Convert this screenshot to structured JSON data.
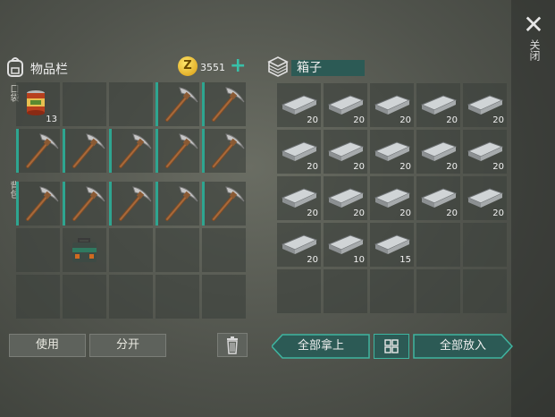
{
  "window": {
    "close_label": "关闭"
  },
  "inventory": {
    "title": "物品栏",
    "coins": "3551",
    "pocket_label": "口袋",
    "backpack_label": "背包",
    "pocket_slots": [
      {
        "item": "can",
        "count": "13"
      },
      {
        "item": "",
        "count": ""
      },
      {
        "item": "",
        "count": ""
      },
      {
        "item": "pickaxe",
        "count": "",
        "hl": true
      },
      {
        "item": "pickaxe",
        "count": "",
        "hl": true
      },
      {
        "item": "pickaxe",
        "count": "",
        "hl": true
      },
      {
        "item": "pickaxe",
        "count": "",
        "hl": true
      },
      {
        "item": "pickaxe",
        "count": "",
        "hl": true
      },
      {
        "item": "pickaxe",
        "count": "",
        "hl": true
      },
      {
        "item": "pickaxe",
        "count": "",
        "hl": true
      }
    ],
    "backpack_slots": [
      {
        "item": "pickaxe",
        "count": "",
        "hl": true
      },
      {
        "item": "pickaxe",
        "count": "",
        "hl": true
      },
      {
        "item": "pickaxe",
        "count": "",
        "hl": true
      },
      {
        "item": "pickaxe",
        "count": "",
        "hl": true
      },
      {
        "item": "pickaxe",
        "count": "",
        "hl": true
      },
      {
        "item": "",
        "count": ""
      },
      {
        "item": "toolbox",
        "count": ""
      },
      {
        "item": "",
        "count": ""
      },
      {
        "item": "",
        "count": ""
      },
      {
        "item": "",
        "count": ""
      },
      {
        "item": "",
        "count": ""
      },
      {
        "item": "",
        "count": ""
      },
      {
        "item": "",
        "count": ""
      },
      {
        "item": "",
        "count": ""
      },
      {
        "item": "",
        "count": ""
      }
    ],
    "buttons": {
      "use": "使用",
      "split": "分开"
    }
  },
  "chest": {
    "name": "箱子",
    "slots": [
      {
        "item": "ingot",
        "count": "20"
      },
      {
        "item": "ingot",
        "count": "20"
      },
      {
        "item": "ingot",
        "count": "20"
      },
      {
        "item": "ingot",
        "count": "20"
      },
      {
        "item": "ingot",
        "count": "20"
      },
      {
        "item": "ingot",
        "count": "20"
      },
      {
        "item": "ingot",
        "count": "20"
      },
      {
        "item": "ingot",
        "count": "20"
      },
      {
        "item": "ingot",
        "count": "20"
      },
      {
        "item": "ingot",
        "count": "20"
      },
      {
        "item": "ingot",
        "count": "20"
      },
      {
        "item": "ingot",
        "count": "20"
      },
      {
        "item": "ingot",
        "count": "20"
      },
      {
        "item": "ingot",
        "count": "20"
      },
      {
        "item": "ingot",
        "count": "20"
      },
      {
        "item": "ingot",
        "count": "20"
      },
      {
        "item": "ingot",
        "count": "10"
      },
      {
        "item": "ingot",
        "count": "15"
      },
      {
        "item": "",
        "count": ""
      },
      {
        "item": "",
        "count": ""
      },
      {
        "item": "",
        "count": ""
      },
      {
        "item": "",
        "count": ""
      },
      {
        "item": "",
        "count": ""
      },
      {
        "item": "",
        "count": ""
      },
      {
        "item": "",
        "count": ""
      }
    ],
    "buttons": {
      "take_all": "全部拿上",
      "put_all": "全部放入"
    }
  },
  "colors": {
    "accent": "#3fb5a0",
    "panel_dark": "#2c5a55",
    "coin": "#e8b520"
  }
}
